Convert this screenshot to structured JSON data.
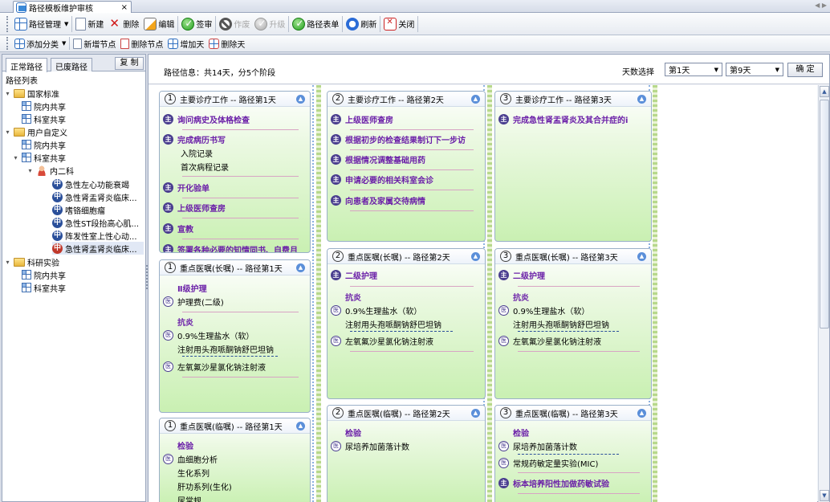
{
  "tab": {
    "title": "路径模板维护审核",
    "close": "×"
  },
  "toolbar1": {
    "path_manage": "路径管理",
    "new": "新建",
    "delete": "删除",
    "edit": "编辑",
    "sign": "签审",
    "void": "作废",
    "upgrade": "升级",
    "route_sheet": "路径表单",
    "refresh": "刷新",
    "close": "关闭"
  },
  "toolbar2": {
    "add_category": "添加分类",
    "add_node": "新增节点",
    "delete_node": "删除节点",
    "add_day": "增加天",
    "delete_day": "删除天"
  },
  "left": {
    "tab_normal": "正常路径",
    "tab_void": "已废路径",
    "copy": "复 制",
    "tree_title": "路径列表",
    "tree": {
      "n1": "国家标准",
      "n1a": "院内共享",
      "n1b": "科室共享",
      "n2": "用户自定义",
      "n2a": "院内共享",
      "n2b": "科室共享",
      "n2b1": "内二科",
      "p1": "急性左心功能衰竭",
      "p2": "急性肾盂肾炎临床...",
      "p3": "嗜铬细胞瘤",
      "p4": "急性ST段抬高心肌...",
      "p5": "阵发性室上性心动...",
      "p6": "急性肾盂肾炎临床...",
      "n3": "科研实验",
      "n3a": "院内共享",
      "n3b": "科室共享",
      "med": "中",
      "med_red": "中"
    }
  },
  "info": {
    "route": "路径信息：共14天，分5个阶段",
    "days_label": "天数选择",
    "from": "第1天",
    "to": "第9天",
    "ok": "确 定"
  },
  "cards": {
    "c11": {
      "num": "1",
      "title": "主要诊疗工作 -- 路径第1天",
      "r1": "询问病史及体格检查",
      "r2": "完成病历书写",
      "r3": "入院记录",
      "r4": "首次病程记录",
      "r5": "开化验单",
      "r6": "上级医师查房",
      "r7": "宣教",
      "r8": "签署各种必要的知情同书、自费月"
    },
    "c12": {
      "num": "1",
      "title": "重点医嘱(长嘱) -- 路径第1天",
      "g1": "Ⅱ级护理",
      "r1": "护理费(二级)",
      "g2": "抗炎",
      "r2": "0.9%生理盐水（软）",
      "r3": "注射用头孢哌酮钠舒巴坦钠",
      "r4": "左氧氟沙星氯化钠注射液"
    },
    "c13": {
      "num": "1",
      "title": "重点医嘱(临嘱) -- 路径第1天",
      "g1": "检验",
      "r1": "血细胞分析",
      "r2": "生化系列",
      "r3": "肝功系列(生化)",
      "r4": "尿常规"
    },
    "c21": {
      "num": "2",
      "title": "主要诊疗工作 -- 路径第2天",
      "r1": "上级医师查房",
      "r2": "根据初步的检查结果制订下一步访",
      "r3": "根据情况调整基础用药",
      "r4": "申请必要的相关科室会诊",
      "r5": "向患者及家属交待病情"
    },
    "c22": {
      "num": "2",
      "title": "重点医嘱(长嘱) -- 路径第2天",
      "r1": "二级护理",
      "g1": "抗炎",
      "r2": "0.9%生理盐水（软）",
      "r3": "注射用头孢哌酮钠舒巴坦钠",
      "r4": "左氧氟沙星氯化钠注射液"
    },
    "c23": {
      "num": "2",
      "title": "重点医嘱(临嘱) -- 路径第2天",
      "g1": "检验",
      "r1": "尿培养加菌落计数"
    },
    "c31": {
      "num": "3",
      "title": "主要诊疗工作 -- 路径第3天",
      "r1": "完成急性肾盂肾炎及其合并症的i"
    },
    "c32": {
      "num": "3",
      "title": "重点医嘱(长嘱) -- 路径第3天",
      "r1": "二级护理",
      "g1": "抗炎",
      "r2": "0.9%生理盐水（软）",
      "r3": "注射用头孢哌酮钠舒巴坦钠",
      "r4": "左氧氟沙星氯化钠注射液"
    },
    "c33": {
      "num": "3",
      "title": "重点医嘱(临嘱) -- 路径第3天",
      "g1": "检验",
      "r1": "尿培养加菌落计数",
      "r2": "常规药敏定量实验(MIC)",
      "r3": "标本培养阳性加做药敏试验"
    }
  },
  "icons": {
    "pi": "主",
    "yi": "医"
  },
  "scroll": {
    "up": "▲",
    "down": "▼"
  }
}
